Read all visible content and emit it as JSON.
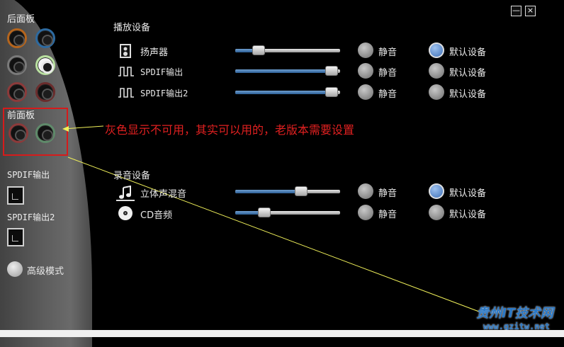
{
  "left_panel": {
    "rear_title": "后面板",
    "front_title": "前面板",
    "spdif_out_label": "SPDIF输出",
    "spdif_out2_label": "SPDIF输出2",
    "advanced_mode_label": "高级模式",
    "rear_jacks": [
      "orange",
      "blue",
      "gray",
      "lime",
      "red",
      "maroon"
    ],
    "front_jacks": [
      "red",
      "green"
    ]
  },
  "window_controls": {
    "minimize": "—",
    "close": "×"
  },
  "playback": {
    "title": "播放设备",
    "devices": [
      {
        "name": "扬声器",
        "icon": "speaker-icon",
        "volume": 0.22,
        "mute_label": "静音",
        "default_label": "默认设备",
        "is_default": true
      },
      {
        "name": "SPDIF输出",
        "icon": "spdif-pulse-icon",
        "volume": 0.92,
        "mute_label": "静音",
        "default_label": "默认设备",
        "is_default": false
      },
      {
        "name": "SPDIF输出2",
        "icon": "spdif-pulse-icon",
        "volume": 0.92,
        "mute_label": "静音",
        "default_label": "默认设备",
        "is_default": false
      }
    ]
  },
  "recording": {
    "title": "录音设备",
    "devices": [
      {
        "name": "立体声混音",
        "icon": "music-note-icon",
        "volume": 0.63,
        "mute_label": "静音",
        "default_label": "默认设备",
        "is_default": true
      },
      {
        "name": "CD音频",
        "icon": "cd-icon",
        "volume": 0.28,
        "mute_label": "静音",
        "default_label": "默认设备",
        "is_default": false
      }
    ]
  },
  "annotation": {
    "text": "灰色显示不可用，其实可以用的，老版本需要设置",
    "color": "#e02020"
  },
  "watermark": {
    "title": "贵州IT技术网",
    "url": "www.gzitw.net"
  },
  "colors": {
    "accent_blue": "#2f63b0",
    "annotation_red": "#d61b1b",
    "leader_line": "#f2f25a"
  }
}
